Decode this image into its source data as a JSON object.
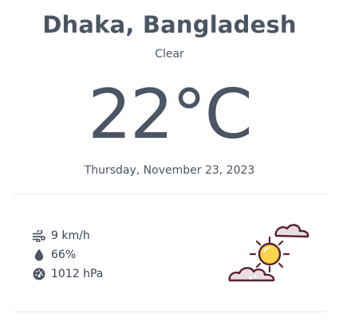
{
  "location": {
    "city": "Dhaka, Bangladesh"
  },
  "weather": {
    "condition": "Clear",
    "temperature": "22°C",
    "date": "Thursday, November 23, 2023"
  },
  "stats": {
    "wind": {
      "icon": "wind-icon",
      "value": "9 km/h"
    },
    "humidity": {
      "icon": "droplet-icon",
      "value": "66%"
    },
    "pressure": {
      "icon": "gauge-icon",
      "value": "1012 hPa"
    }
  },
  "weather_icon": "sun-with-clouds-icon",
  "colors": {
    "text": "#4b5563",
    "divider": "#e5e7eb",
    "sun": "#fcd34d",
    "cloud_outline": "#5b1f34",
    "cloud_fill": "#e9dde3"
  }
}
